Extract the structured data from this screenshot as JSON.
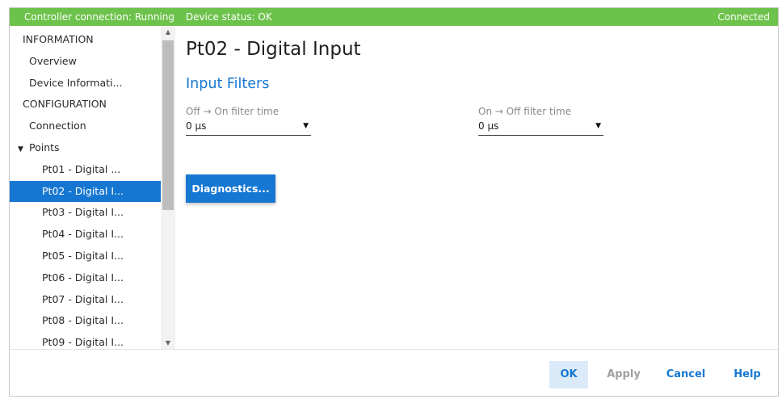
{
  "status_bar": {
    "controller_connection": "Controller connection: Running",
    "device_status": "Device status: OK",
    "connection_state": "Connected",
    "color": "#6cc24a"
  },
  "sidebar": {
    "items": [
      {
        "type": "section",
        "label": "INFORMATION"
      },
      {
        "type": "item",
        "label": "Overview"
      },
      {
        "type": "item",
        "label": "Device Informati..."
      },
      {
        "type": "section",
        "label": "CONFIGURATION"
      },
      {
        "type": "item",
        "label": "Connection"
      },
      {
        "type": "group",
        "label": "Points",
        "icon": "triangle-down-icon"
      },
      {
        "type": "point",
        "label": "Pt01 - Digital ..."
      },
      {
        "type": "point",
        "label": "Pt02 - Digital I...",
        "selected": true
      },
      {
        "type": "point",
        "label": "Pt03 - Digital I..."
      },
      {
        "type": "point",
        "label": "Pt04 - Digital I..."
      },
      {
        "type": "point",
        "label": "Pt05 - Digital I..."
      },
      {
        "type": "point",
        "label": "Pt06 - Digital I..."
      },
      {
        "type": "point",
        "label": "Pt07 - Digital I..."
      },
      {
        "type": "point",
        "label": "Pt08 - Digital I..."
      },
      {
        "type": "point",
        "label": "Pt09 - Digital I..."
      }
    ]
  },
  "main": {
    "title": "Pt02 - Digital Input",
    "section_title": "Input Filters",
    "filters": {
      "off_on": {
        "label": "Off → On filter time",
        "value": "0 µs"
      },
      "on_off": {
        "label": "On → Off filter time",
        "value": "0 µs"
      }
    },
    "diagnostics_button": "Diagnostics..."
  },
  "footer": {
    "ok": "OK",
    "apply": "Apply",
    "cancel": "Cancel",
    "help": "Help"
  },
  "colors": {
    "accent": "#1677d2",
    "status_bar": "#6cc24a",
    "ok_background": "#dbeaf8",
    "disabled_text": "#a0a0a0"
  }
}
